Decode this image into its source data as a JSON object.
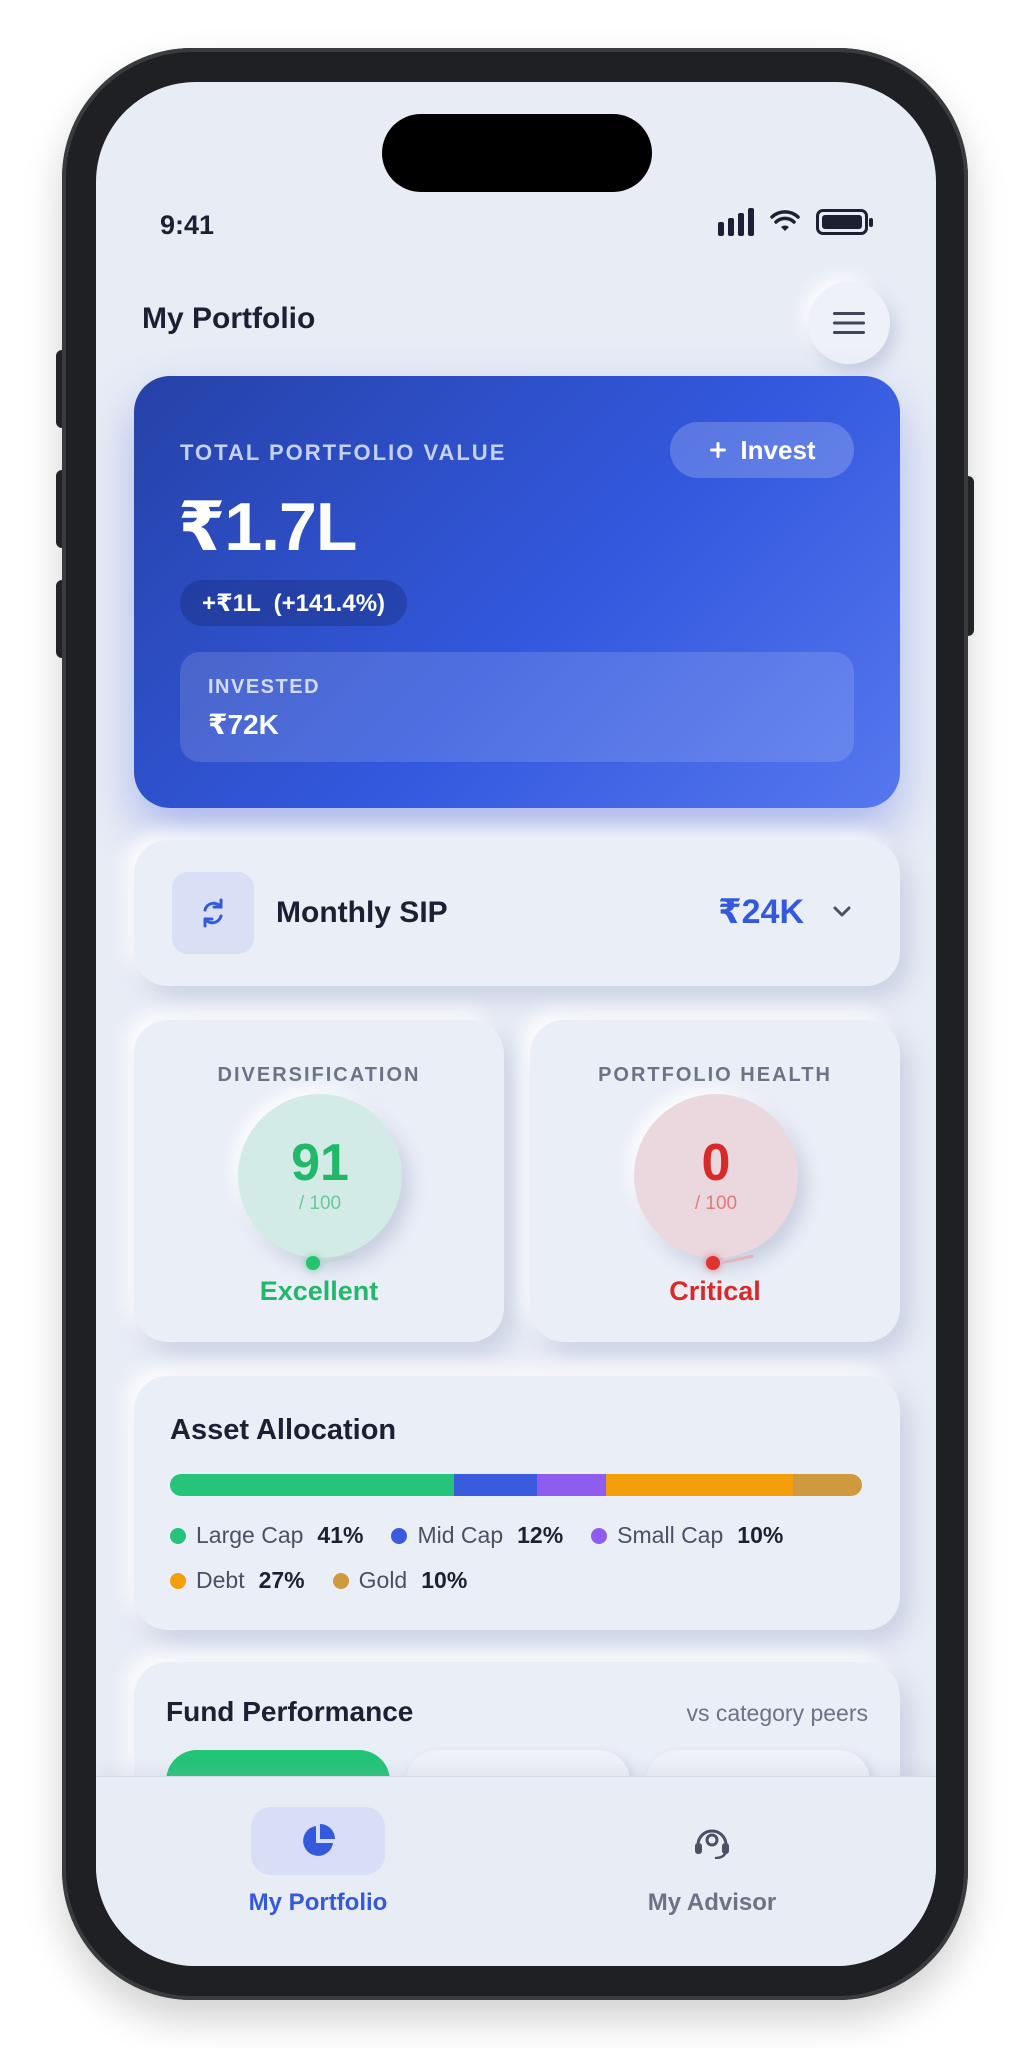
{
  "status_bar": {
    "time": "9:41"
  },
  "header": {
    "title": "My Portfolio",
    "menu_icon": "hamburger-menu-icon"
  },
  "portfolio": {
    "label": "TOTAL PORTFOLIO VALUE",
    "value": "₹1.7L",
    "gain": "+₹1L  (+141.4%)",
    "invest_button": "Invest",
    "invested_label": "INVESTED",
    "invested_value": "₹72K"
  },
  "sip": {
    "label": "Monthly SIP",
    "value": "₹24K"
  },
  "scores": {
    "diversification": {
      "label": "DIVERSIFICATION",
      "score": "91",
      "max": "/ 100",
      "status": "Excellent"
    },
    "health": {
      "label": "PORTFOLIO HEALTH",
      "score": "0",
      "max": "/ 100",
      "status": "Critical"
    }
  },
  "allocation": {
    "title": "Asset Allocation",
    "items": [
      {
        "name": "Large Cap",
        "pct": "41%",
        "value": 41,
        "color": "#26c47a"
      },
      {
        "name": "Mid Cap",
        "pct": "12%",
        "value": 12,
        "color": "#3a5bde"
      },
      {
        "name": "Small Cap",
        "pct": "10%",
        "value": 10,
        "color": "#8f5cf0"
      },
      {
        "name": "Debt",
        "pct": "27%",
        "value": 27,
        "color": "#f59e0b"
      },
      {
        "name": "Gold",
        "pct": "10%",
        "value": 10,
        "color": "#cf9a3e"
      }
    ]
  },
  "fund_performance": {
    "title": "Fund Performance",
    "subtitle": "vs category peers"
  },
  "bottom_nav": [
    {
      "label": "My Portfolio",
      "icon": "pie-chart-icon",
      "active": true
    },
    {
      "label": "My Advisor",
      "icon": "advisor-headset-icon",
      "active": false
    }
  ],
  "colors": {
    "accent": "#3559dc",
    "success": "#22b86a",
    "danger": "#d92a2a"
  }
}
